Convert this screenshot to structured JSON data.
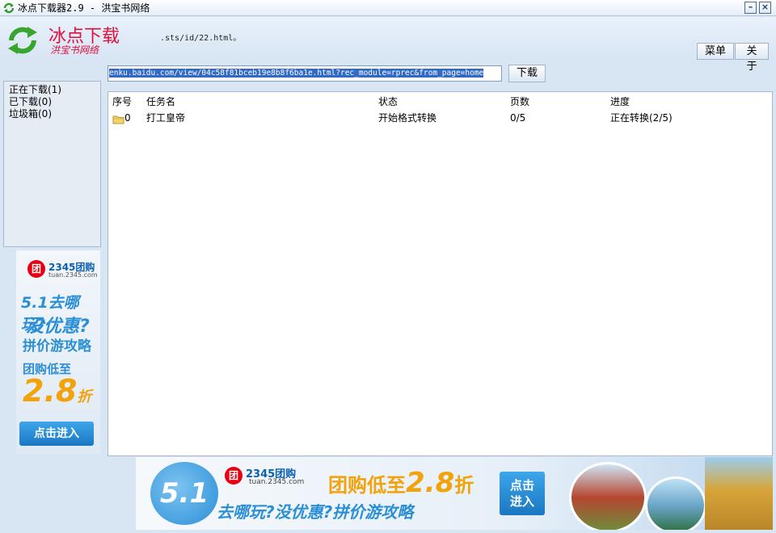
{
  "window": {
    "title": "冰点下载器2.9 - 洪宝书网络",
    "minimize": "–",
    "close": "×"
  },
  "header": {
    "app_name": "冰点下载",
    "app_subtitle": "洪宝书网络",
    "url_fragment": ".sts/id/22.html。",
    "menu_label": "菜单",
    "about_label": "关于"
  },
  "url_bar": {
    "value": "enku.baidu.com/view/04c58f81bceb19e8b8f6ba1e.html?rec_module=rprec&from_page=home",
    "download_label": "下载"
  },
  "sidebar": {
    "items": [
      {
        "label": "正在下载(1)"
      },
      {
        "label": "已下载(0)"
      },
      {
        "label": "垃圾箱(0)"
      }
    ]
  },
  "table": {
    "headers": [
      "序号",
      "任务名",
      "状态",
      "页数",
      "进度"
    ],
    "rows": [
      {
        "index": "0",
        "name": "打工皇帝",
        "status": "开始格式转换",
        "pages": "0/5",
        "progress": "正在转换(2/5)"
      }
    ]
  },
  "left_ad": {
    "brand": "2345团购",
    "site": "tuan.2345.com",
    "line1": "5.1去哪玩?",
    "line2": "没优惠?",
    "line3": "拼价游攻略",
    "line4": "团购低至",
    "price": "2.8",
    "price_unit": "折",
    "button": "点击进入"
  },
  "bottom_ad": {
    "badge": "5.1",
    "brand": "2345团购",
    "site": "tuan.2345.com",
    "promo_prefix": "团购低至",
    "price": "2.8",
    "price_unit": "折",
    "subline": "去哪玩?没优惠?拼价游攻略",
    "button_line1": "点击",
    "button_line2": "进入"
  },
  "colors": {
    "brand_red": "#e0103a",
    "ad_blue": "#2b8fd6",
    "ad_orange": "#f2a20a",
    "selection": "#316ac5"
  }
}
